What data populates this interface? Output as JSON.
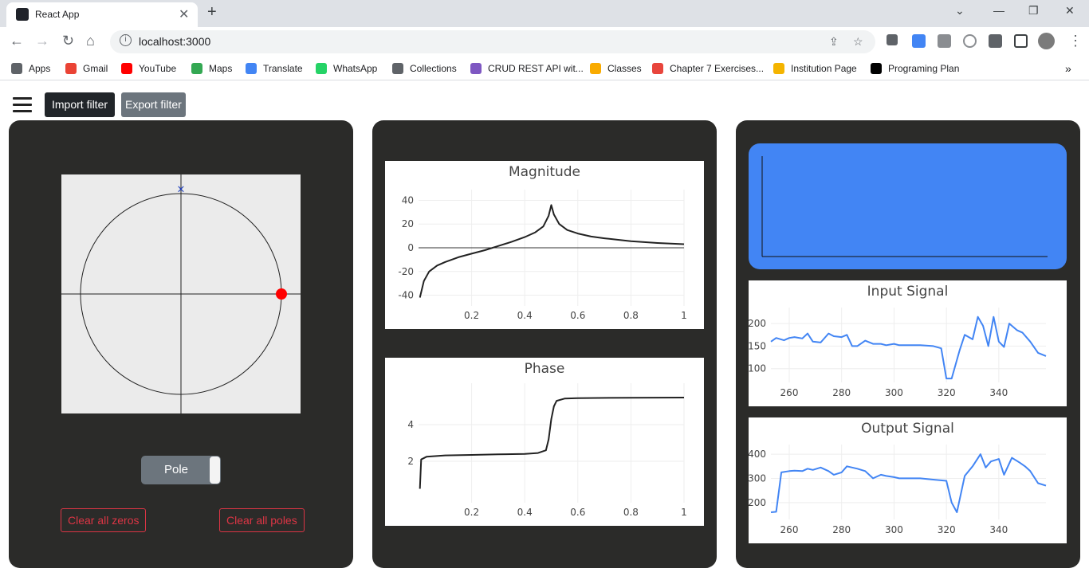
{
  "browser": {
    "tab_title": "React App",
    "url": "localhost:3000",
    "bookmarks": [
      {
        "label": "Apps",
        "icon": "apps-grid-icon",
        "color": "#5f6368"
      },
      {
        "label": "Gmail",
        "icon": "gmail-icon",
        "color": "#ea4335"
      },
      {
        "label": "YouTube",
        "icon": "youtube-icon",
        "color": "#ff0000"
      },
      {
        "label": "Maps",
        "icon": "maps-pin-icon",
        "color": "#34a853"
      },
      {
        "label": "Translate",
        "icon": "translate-icon",
        "color": "#4285f4"
      },
      {
        "label": "WhatsApp",
        "icon": "whatsapp-icon",
        "color": "#25d366"
      },
      {
        "label": "Collections",
        "icon": "collections-icon",
        "color": "#5f6368"
      },
      {
        "label": "CRUD REST API wit...",
        "icon": "crud-icon",
        "color": "#7e57c2"
      },
      {
        "label": "Classes",
        "icon": "classes-icon",
        "color": "#f9ab00"
      },
      {
        "label": "Chapter 7 Exercises...",
        "icon": "chapter-icon",
        "color": "#e8453c"
      },
      {
        "label": "Institution Page",
        "icon": "institution-icon",
        "color": "#f4b400"
      },
      {
        "label": "Programing Plan",
        "icon": "notion-icon",
        "color": "#000000"
      }
    ],
    "more_bookmarks": "»"
  },
  "toolbar": {
    "import_label": "Import filter",
    "export_label": "Export filter"
  },
  "zplane": {
    "toggle_label": "Pole",
    "clear_zeros_label": "Clear all zeros",
    "clear_poles_label": "Clear all poles",
    "zeros": [
      {
        "re": 1.0,
        "im": 0.0
      }
    ],
    "poles": [
      {
        "re": 0.0,
        "im": 1.05
      }
    ]
  },
  "colors": {
    "panel_bg": "#2b2b29",
    "accent_blue": "#4285f4",
    "danger_red": "#dc3545",
    "zero_marker": "#ff0000",
    "pole_marker": "#1f3fbf"
  },
  "chart_data": [
    {
      "type": "line",
      "title": "Magnitude",
      "xlim": [
        0,
        1
      ],
      "ylim": [
        -45,
        45
      ],
      "xticks": [
        0.2,
        0.4,
        0.6,
        0.8,
        1
      ],
      "yticks": [
        40,
        20,
        0,
        -20,
        -40
      ],
      "x": [
        0.005,
        0.02,
        0.04,
        0.07,
        0.1,
        0.15,
        0.2,
        0.25,
        0.3,
        0.35,
        0.4,
        0.44,
        0.47,
        0.49,
        0.5,
        0.51,
        0.53,
        0.56,
        0.6,
        0.65,
        0.7,
        0.8,
        0.9,
        1.0
      ],
      "y": [
        -42,
        -28,
        -20,
        -15,
        -12,
        -8,
        -5,
        -2,
        1.5,
        5,
        9,
        13,
        18,
        27,
        36,
        28,
        20,
        15,
        12,
        9.5,
        8,
        5.5,
        4,
        3
      ]
    },
    {
      "type": "line",
      "title": "Phase",
      "xlim": [
        0,
        1
      ],
      "ylim": [
        0,
        6
      ],
      "xticks": [
        0.2,
        0.4,
        0.6,
        0.8,
        1
      ],
      "yticks": [
        4,
        2
      ],
      "x": [
        0.005,
        0.01,
        0.03,
        0.1,
        0.2,
        0.3,
        0.4,
        0.45,
        0.48,
        0.49,
        0.5,
        0.51,
        0.52,
        0.55,
        0.6,
        0.8,
        1.0
      ],
      "y": [
        0.5,
        2.1,
        2.25,
        2.32,
        2.35,
        2.38,
        2.4,
        2.45,
        2.6,
        3.2,
        4.3,
        5.0,
        5.3,
        5.42,
        5.45,
        5.47,
        5.48
      ]
    },
    {
      "type": "line",
      "title": "Input Signal",
      "xlim": [
        253,
        358
      ],
      "ylim": [
        80,
        225
      ],
      "xticks": [
        260,
        280,
        300,
        320,
        340
      ],
      "yticks": [
        200,
        150,
        100
      ],
      "x": [
        253,
        255,
        258,
        260,
        262,
        265,
        267,
        269,
        272,
        275,
        277,
        280,
        282,
        284,
        286,
        289,
        292,
        295,
        297,
        300,
        302,
        305,
        310,
        315,
        318,
        320,
        322,
        325,
        327,
        330,
        332,
        334,
        336,
        338,
        340,
        342,
        344,
        347,
        349,
        352,
        355,
        358
      ],
      "y": [
        160,
        168,
        163,
        168,
        170,
        167,
        178,
        160,
        158,
        178,
        172,
        170,
        175,
        150,
        150,
        162,
        155,
        155,
        152,
        155,
        152,
        152,
        152,
        150,
        145,
        78,
        78,
        140,
        175,
        165,
        215,
        195,
        150,
        215,
        160,
        148,
        200,
        185,
        180,
        160,
        135,
        128
      ]
    },
    {
      "type": "line",
      "title": "Output Signal",
      "xlim": [
        253,
        358
      ],
      "ylim": [
        150,
        420
      ],
      "xticks": [
        260,
        280,
        300,
        320,
        340
      ],
      "yticks": [
        400,
        300,
        200
      ],
      "x": [
        253,
        255,
        257,
        260,
        262,
        265,
        267,
        269,
        272,
        275,
        277,
        280,
        282,
        284,
        286,
        289,
        292,
        295,
        297,
        300,
        302,
        305,
        310,
        315,
        320,
        322,
        324,
        327,
        330,
        333,
        335,
        337,
        340,
        342,
        345,
        348,
        350,
        352,
        355,
        358
      ],
      "y": [
        160,
        162,
        325,
        330,
        332,
        330,
        340,
        335,
        345,
        330,
        315,
        325,
        350,
        345,
        340,
        330,
        300,
        315,
        310,
        305,
        300,
        300,
        300,
        295,
        290,
        200,
        160,
        310,
        350,
        400,
        345,
        370,
        380,
        315,
        385,
        365,
        350,
        330,
        280,
        270
      ]
    }
  ]
}
